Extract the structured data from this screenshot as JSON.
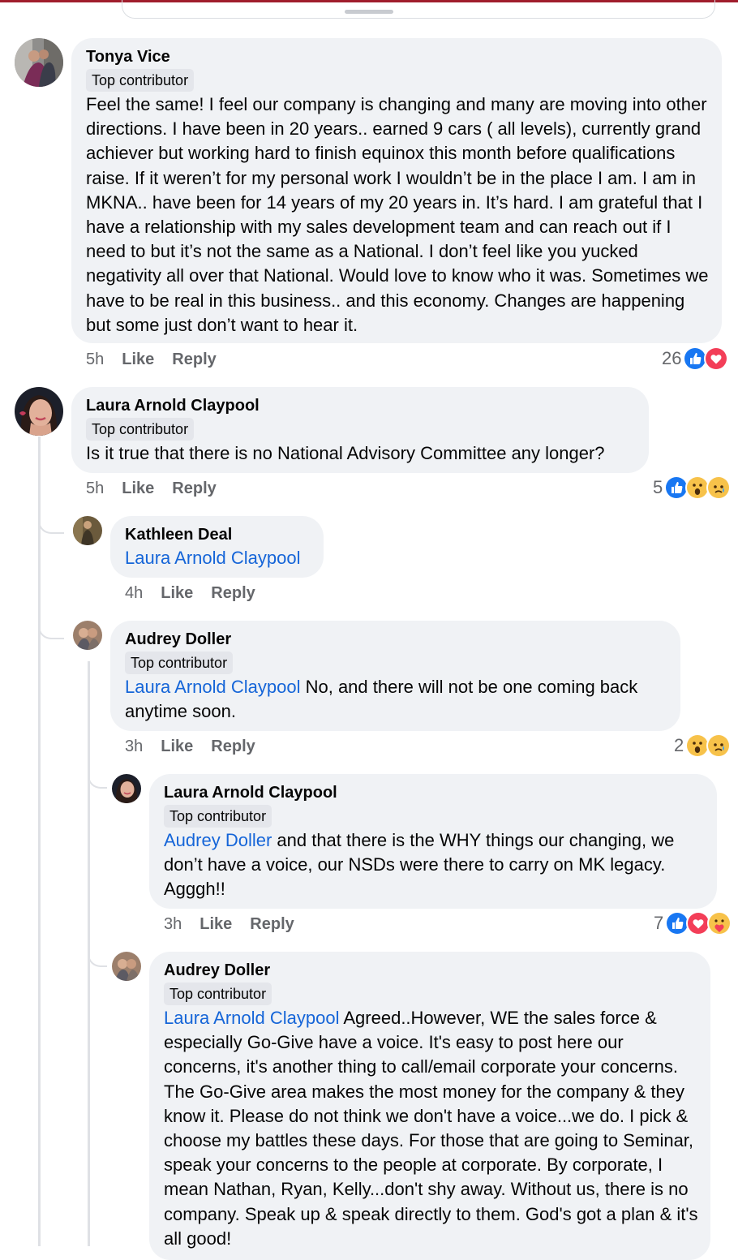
{
  "comments": [
    {
      "author": "Tonya Vice",
      "badge": "Top contributor",
      "text": "Feel the same! I feel our company is changing and many are moving into other directions. I have been in 20 years.. earned 9 cars ( all levels), currently grand achiever but working hard to finish equinox this month before qualifications raise. If it weren’t for my personal work I wouldn’t be in the place I am. I am in MKNA.. have been for 14 years of my 20 years in. It’s hard. I am grateful that I have a relationship with my sales development team and can reach out if I need to but it’s not the same as a National. I don’t feel like you yucked negativity all over that National. Would love to know who it was. Sometimes we have to be real in this business.. and this economy. Changes are happening but some just don’t want to hear it.",
      "time": "5h",
      "like": "Like",
      "reply": "Reply",
      "reaction_count": "26",
      "reactions": [
        "like-icon",
        "love-icon"
      ]
    },
    {
      "author": "Laura Arnold Claypool",
      "badge": "Top contributor",
      "text": "Is it true that there is no National Advisory Committee any longer?",
      "time": "5h",
      "like": "Like",
      "reply": "Reply",
      "reaction_count": "5",
      "reactions": [
        "like-icon",
        "wow-icon",
        "sad-icon"
      ]
    },
    {
      "author": "Kathleen Deal",
      "mention": "Laura Arnold Claypool",
      "text": "",
      "time": "4h",
      "like": "Like",
      "reply": "Reply"
    },
    {
      "author": "Audrey Doller",
      "badge": "Top contributor",
      "mention": "Laura Arnold Claypool",
      "text": " No, and there will not be one coming back anytime soon.",
      "time": "3h",
      "like": "Like",
      "reply": "Reply",
      "reaction_count": "2",
      "reactions": [
        "wow-icon",
        "sad-icon"
      ]
    },
    {
      "author": "Laura Arnold Claypool",
      "badge": "Top contributor",
      "mention": "Audrey Doller",
      "text": " and that there is the WHY things our changing, we don’t have a voice, our NSDs were there to carry on MK legacy. Agggh!!",
      "time": "3h",
      "like": "Like",
      "reply": "Reply",
      "reaction_count": "7",
      "reactions": [
        "like-icon",
        "love-icon",
        "care-icon"
      ]
    },
    {
      "author": "Audrey Doller",
      "badge": "Top contributor",
      "mention": "Laura Arnold Claypool",
      "text": " Agreed..However, WE the sales force & especially Go-Give have a voice. It's easy to post here our concerns, it's another thing to call/email corporate your concerns. The Go-Give area makes the most money for the company & they know it. Please do not think we don't have a voice...we do. I pick & choose my battles these days. For those that are going to Seminar, speak your concerns to the people at corporate. By corporate, I mean Nathan, Ryan, Kelly...don't shy away. Without us, there is no company. Speak up & speak directly to them. God's got a plan & it's all good!"
    }
  ],
  "colors": {
    "bubble": "#f0f2f5",
    "mention": "#1565d8",
    "meta": "#65676b",
    "badge": "#e4e6eb",
    "like": "#1877f2",
    "love": "#f33e58"
  }
}
